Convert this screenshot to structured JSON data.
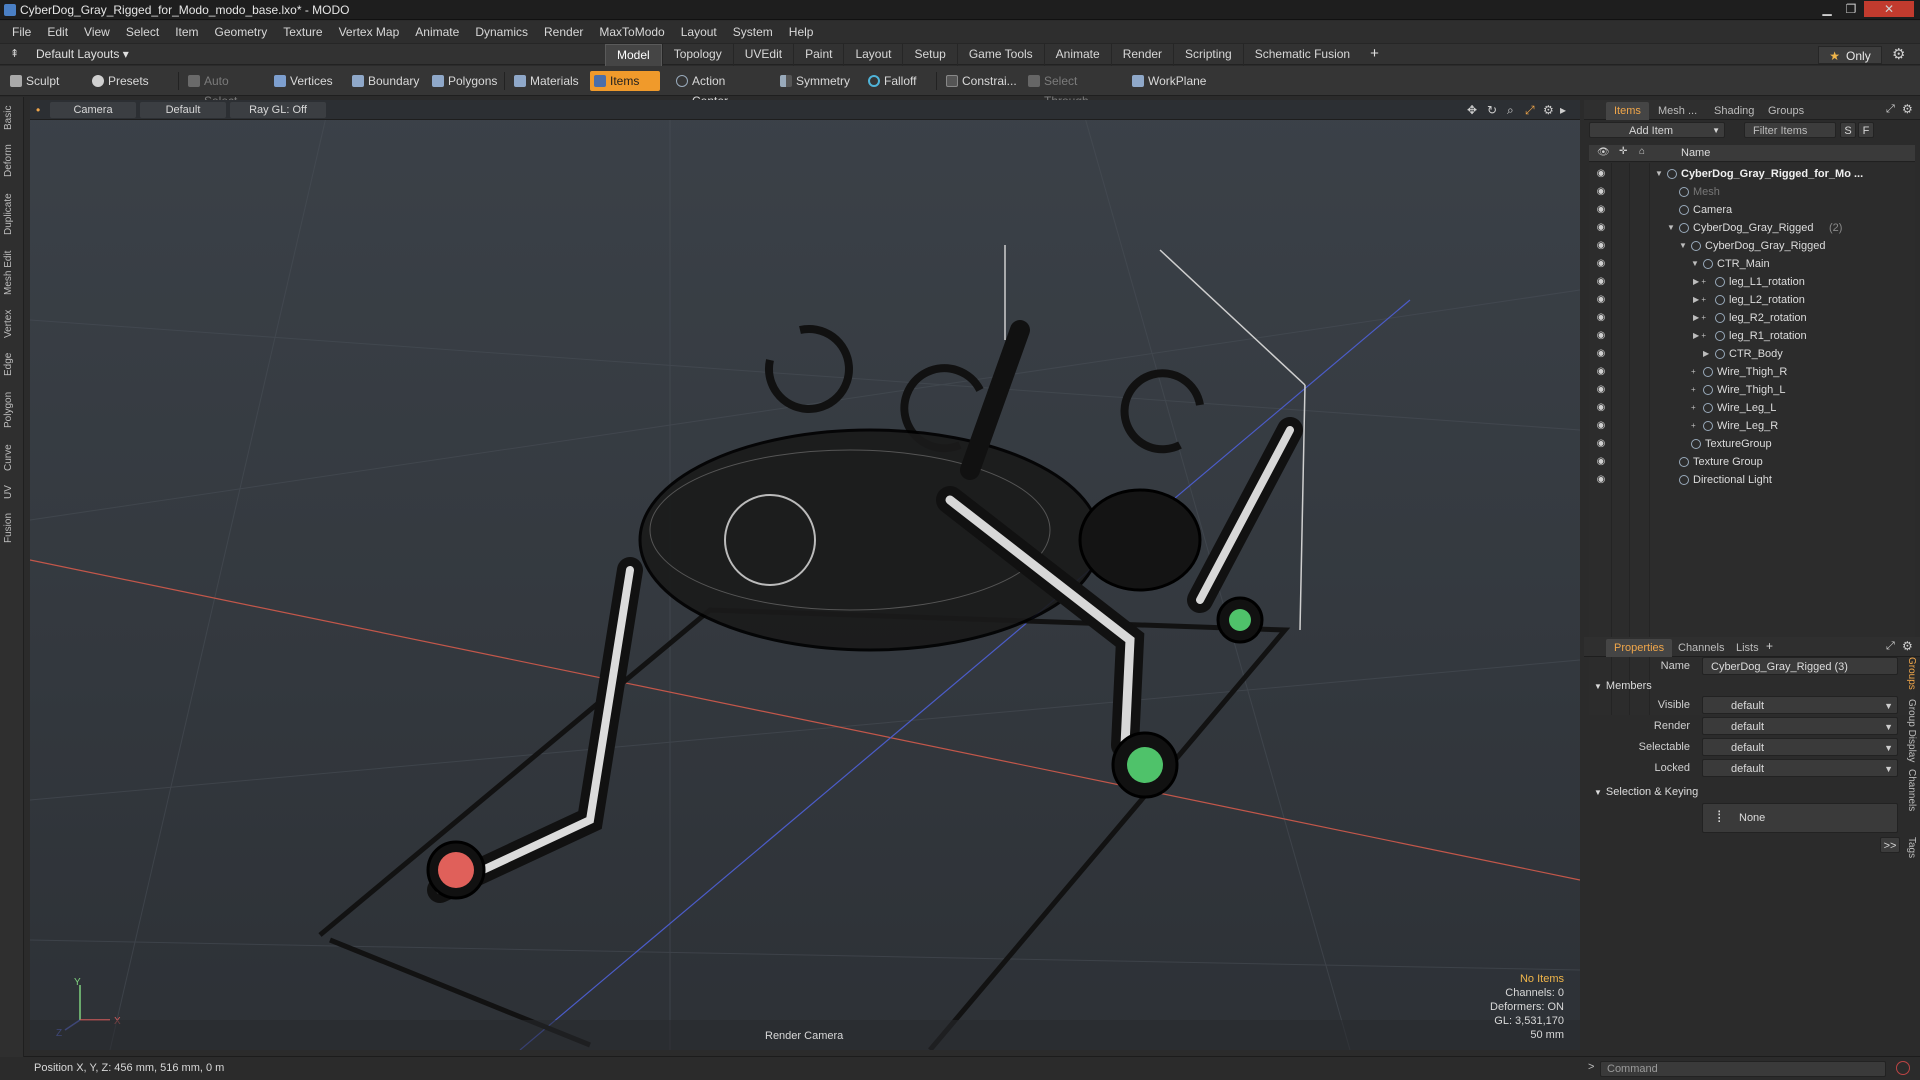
{
  "window": {
    "title": "CyberDog_Gray_Rigged_for_Modo_modo_base.lxo* - MODO"
  },
  "menu": [
    "File",
    "Edit",
    "View",
    "Select",
    "Item",
    "Geometry",
    "Texture",
    "Vertex Map",
    "Animate",
    "Dynamics",
    "Render",
    "MaxToModo",
    "Layout",
    "System",
    "Help"
  ],
  "layout": {
    "preset": "Default Layouts ▾",
    "tabs": [
      "Model",
      "Topology",
      "UVEdit",
      "Paint",
      "Layout",
      "Setup",
      "Game Tools",
      "Animate",
      "Render",
      "Scripting",
      "Schematic Fusion"
    ],
    "active_tab": "Model",
    "only_label": "Only"
  },
  "toolbar": {
    "sculpt": "Sculpt",
    "presets": "Presets",
    "auto_select": "Auto Select",
    "vertices": "Vertices",
    "boundary": "Boundary",
    "polygons": "Polygons",
    "materials": "Materials",
    "items": "Items",
    "action_center": "Action Center",
    "symmetry": "Symmetry",
    "falloff": "Falloff",
    "constraints": "Constrai...",
    "select_through": "Select Through",
    "workplane": "WorkPlane"
  },
  "left_tabs": [
    "Basic",
    "Deform",
    "Duplicate",
    "Mesh Edit",
    "Vertex",
    "Edge",
    "Polygon",
    "Curve",
    "UV",
    "Fusion"
  ],
  "viewport": {
    "camera_btn": "Camera",
    "shading_btn": "Default",
    "raygl_btn": "Ray GL: Off",
    "info": {
      "items": "No Items",
      "channels": "Channels: 0",
      "deformers": "Deformers: ON",
      "gl": "GL: 3,531,170",
      "focal": "50 mm"
    },
    "render_camera": "Render Camera",
    "axis_labels": {
      "y": "Y",
      "z": "Z",
      "x": "X"
    }
  },
  "items_panel": {
    "tabs": [
      "Items",
      "Mesh ...",
      "Shading",
      "Groups"
    ],
    "active_tab": "Items",
    "add_item": "Add Item",
    "filter_placeholder": "Filter Items",
    "btn_s": "S",
    "btn_f": "F",
    "col_name": "Name",
    "tree": [
      {
        "label": "CyberDog_Gray_Rigged_for_Mo ...",
        "depth": 0,
        "root": true,
        "exp": "▼"
      },
      {
        "label": "Mesh",
        "depth": 1,
        "dim": true,
        "exp": ""
      },
      {
        "label": "Camera",
        "depth": 1,
        "exp": ""
      },
      {
        "label": "CyberDog_Gray_Rigged",
        "count": "(2)",
        "depth": 1,
        "exp": "▼"
      },
      {
        "label": "CyberDog_Gray_Rigged",
        "depth": 2,
        "exp": "▼"
      },
      {
        "label": "CTR_Main",
        "depth": 3,
        "exp": "▼"
      },
      {
        "label": "leg_L1_rotation",
        "depth": 4,
        "exp": "▶ +"
      },
      {
        "label": "leg_L2_rotation",
        "depth": 4,
        "exp": "▶ +"
      },
      {
        "label": "leg_R2_rotation",
        "depth": 4,
        "exp": "▶ +"
      },
      {
        "label": "leg_R1_rotation",
        "depth": 4,
        "exp": "▶ +"
      },
      {
        "label": "CTR_Body",
        "depth": 4,
        "exp": "▶"
      },
      {
        "label": "Wire_Thigh_R",
        "depth": 3,
        "exp": "+"
      },
      {
        "label": "Wire_Thigh_L",
        "depth": 3,
        "exp": "+"
      },
      {
        "label": "Wire_Leg_L",
        "depth": 3,
        "exp": "+"
      },
      {
        "label": "Wire_Leg_R",
        "depth": 3,
        "exp": "+"
      },
      {
        "label": "TextureGroup",
        "depth": 2,
        "exp": ""
      },
      {
        "label": "Texture Group",
        "depth": 1,
        "exp": ""
      },
      {
        "label": "Directional Light",
        "depth": 1,
        "exp": ""
      }
    ]
  },
  "properties": {
    "tabs": [
      "Properties",
      "Channels",
      "Lists"
    ],
    "active_tab": "Properties",
    "name_label": "Name",
    "name_value": "CyberDog_Gray_Rigged (3)",
    "members": "Members",
    "fields": [
      {
        "label": "Visible",
        "value": "default"
      },
      {
        "label": "Render",
        "value": "default"
      },
      {
        "label": "Selectable",
        "value": "default"
      },
      {
        "label": "Locked",
        "value": "default"
      }
    ],
    "sel_keying": "Selection & Keying",
    "none_btn": "None",
    "more_btn": ">>",
    "side_tabs": [
      "Groups",
      "Group Display",
      "User Channels",
      "Tags"
    ]
  },
  "status": {
    "position": "Position X, Y, Z:  456 mm, 516 mm, 0 m"
  },
  "command": {
    "placeholder": "Command"
  },
  "colors": {
    "accent": "#f09a2b",
    "bg": "#2b2b2b",
    "viewport": "#373c42"
  }
}
